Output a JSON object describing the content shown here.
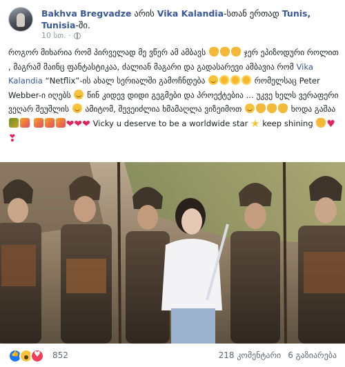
{
  "post": {
    "author": "Bakhva Bregvadze",
    "with_prefix": " არის ",
    "tagged": "Vika Kalandia",
    "with_suffix": "-სთან ერთად ",
    "location": "Tunis, Tunisia",
    "location_suffix": "-ში.",
    "time": "10 სთ. ·",
    "privacy_icon": "globe-icon"
  },
  "text": {
    "line1": "როგორ მიხარია რომ პირველად მე ვწერ ამ ამბავს",
    "line1b": "ჯერ ეპიზოდური როლით , მაგრამ მაინც ფანტასტიკაა, ძალიან მაგარი და გადასარევი ამბავია რომ",
    "tag2": "Vika Kalandia",
    "netflix": "“Netflix”-ის ახალ სერიალში გამოჩნდება",
    "line3": "რომელსაც Peter Webber-ი იღებს",
    "line3b": "წინ კიდევ დიდი გეგმები და პროექტებია ... უკვე ხელს ვერაფერი ვეღარ შეუშლის",
    "line4": "ამიტომ, შევეიძლია ხმამაღლა ვიზეიმოთ",
    "line4b": "ხოდა გაშაა",
    "line5": "Vicky u deserve to be a worldwide star",
    "line5b": "keep shining"
  },
  "footer": {
    "reaction_count": "852",
    "comments": "218 კომენტარი",
    "shares": "6 გაზიარება"
  },
  "colors": {
    "link": "#385898",
    "meta": "#90949c"
  }
}
